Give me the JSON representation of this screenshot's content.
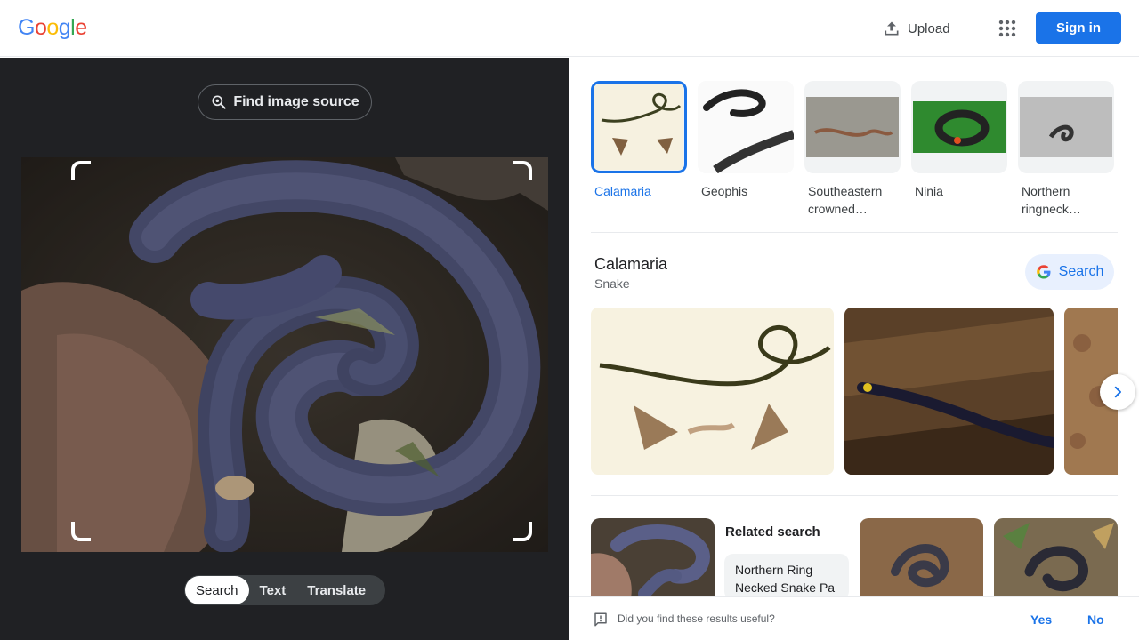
{
  "header": {
    "logo_letters": [
      "G",
      "o",
      "o",
      "g",
      "l",
      "e"
    ],
    "logo_colors": [
      "#4285f4",
      "#ea4335",
      "#fbbc05",
      "#4285f4",
      "#34a853",
      "#ea4335"
    ],
    "upload_label": "Upload",
    "upload_icon": "upload-icon",
    "apps_icon": "apps-grid-icon",
    "signin_label": "Sign in"
  },
  "left": {
    "find_source_label": "Find image source",
    "find_source_icon": "lens-search-icon",
    "modes": [
      {
        "label": "Search",
        "active": true
      },
      {
        "label": "Text",
        "active": false
      },
      {
        "label": "Translate",
        "active": false
      }
    ]
  },
  "results": {
    "chips": [
      {
        "label": "Calamaria",
        "selected": true
      },
      {
        "label": "Geophis",
        "selected": false
      },
      {
        "label": "Southeastern crowned…",
        "line1": "Southeastern",
        "line2": "crowned…",
        "selected": false
      },
      {
        "label": "Ninia",
        "selected": false
      },
      {
        "label": "Northern ringneck…",
        "line1": "Northern",
        "line2": "ringneck…",
        "selected": false
      }
    ],
    "kg": {
      "title": "Calamaria",
      "subtitle": "Snake",
      "search_label": "Search"
    },
    "related": {
      "title": "Related search",
      "chip_line1": "Northern Ring",
      "chip_line2": "Necked Snake Pa"
    }
  },
  "feedback": {
    "question": "Did you find these results useful?",
    "yes": "Yes",
    "no": "No"
  },
  "colors": {
    "accent": "#1a73e8",
    "dark_bg": "#202124"
  }
}
